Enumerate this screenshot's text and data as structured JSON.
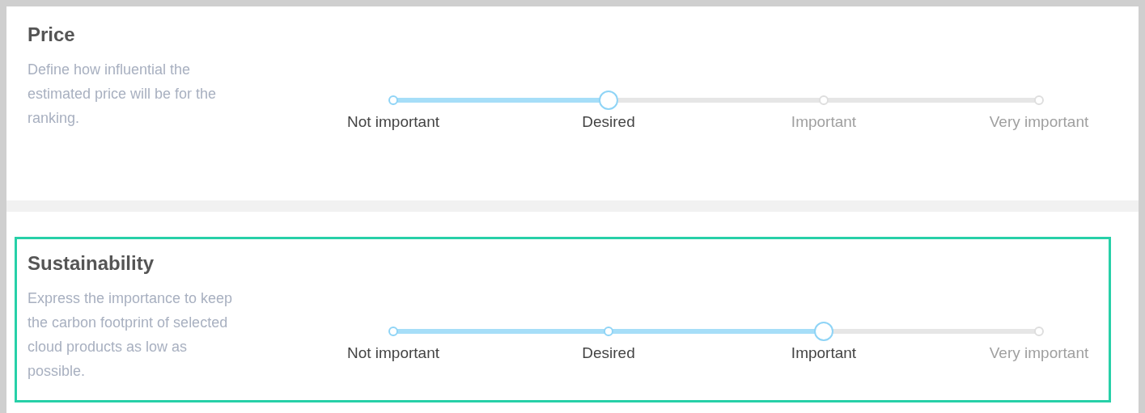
{
  "sections": [
    {
      "title": "Price",
      "description": "Define how influential the estimated price will be for the ranking.",
      "highlighted": false,
      "slider": {
        "level": 0.3333,
        "labels": [
          "Not important",
          "Desired",
          "Important",
          "Very important"
        ]
      }
    },
    {
      "title": "Sustainability",
      "description": "Express the importance to keep the carbon footprint of selected cloud products as low as possible.",
      "highlighted": true,
      "slider": {
        "level": 0.6667,
        "labels": [
          "Not important",
          "Desired",
          "Important",
          "Very important"
        ]
      }
    }
  ]
}
